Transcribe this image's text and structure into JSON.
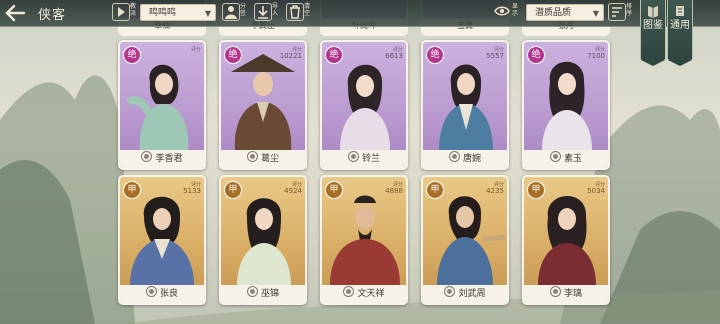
{
  "header": {
    "back_icon": "arrow-left-icon",
    "title": "侠客",
    "sect_filter_label": "教派",
    "sect_filter_value": "鸣鸣鸣",
    "split_label": "分签",
    "import_label": "导入",
    "clear_label": "清空",
    "reveal_label": "显示",
    "sort_label": "排序",
    "quality_select_value": "潜质品质"
  },
  "side_tabs": [
    {
      "label": "图鉴",
      "icon": "book-icon"
    },
    {
      "label": "通用",
      "icon": "scroll-icon"
    }
  ],
  "partial_cards": [
    {
      "name": "草柚"
    },
    {
      "name": "李翼止"
    },
    {
      "name": "叶阁吟"
    },
    {
      "name": "宝真"
    },
    {
      "name": "张月"
    }
  ],
  "cards_row1": [
    {
      "grade": "绝",
      "power_label": "评分",
      "power": "",
      "name": "李香君"
    },
    {
      "grade": "绝",
      "power_label": "评分",
      "power": "10221",
      "name": "葛尘"
    },
    {
      "grade": "绝",
      "power_label": "评分",
      "power": "6613",
      "name": "铃兰"
    },
    {
      "grade": "绝",
      "power_label": "评分",
      "power": "5557",
      "name": "唐婉"
    },
    {
      "grade": "绝",
      "power_label": "评分",
      "power": "7100",
      "name": "素玉"
    }
  ],
  "cards_row2": [
    {
      "grade": "甲",
      "power_label": "评分",
      "power": "5133",
      "name": "张良"
    },
    {
      "grade": "甲",
      "power_label": "评分",
      "power": "4924",
      "name": "巫锦"
    },
    {
      "grade": "甲",
      "power_label": "评分",
      "power": "4888",
      "name": "文天祥"
    },
    {
      "grade": "甲",
      "power_label": "评分",
      "power": "4235",
      "name": "刘武周"
    },
    {
      "grade": "甲",
      "power_label": "评分",
      "power": "5034",
      "name": "李璃"
    }
  ],
  "colors": {
    "accent_purple": "#b3358d",
    "accent_gold": "#a86e24",
    "topbar": "#2f4540"
  }
}
